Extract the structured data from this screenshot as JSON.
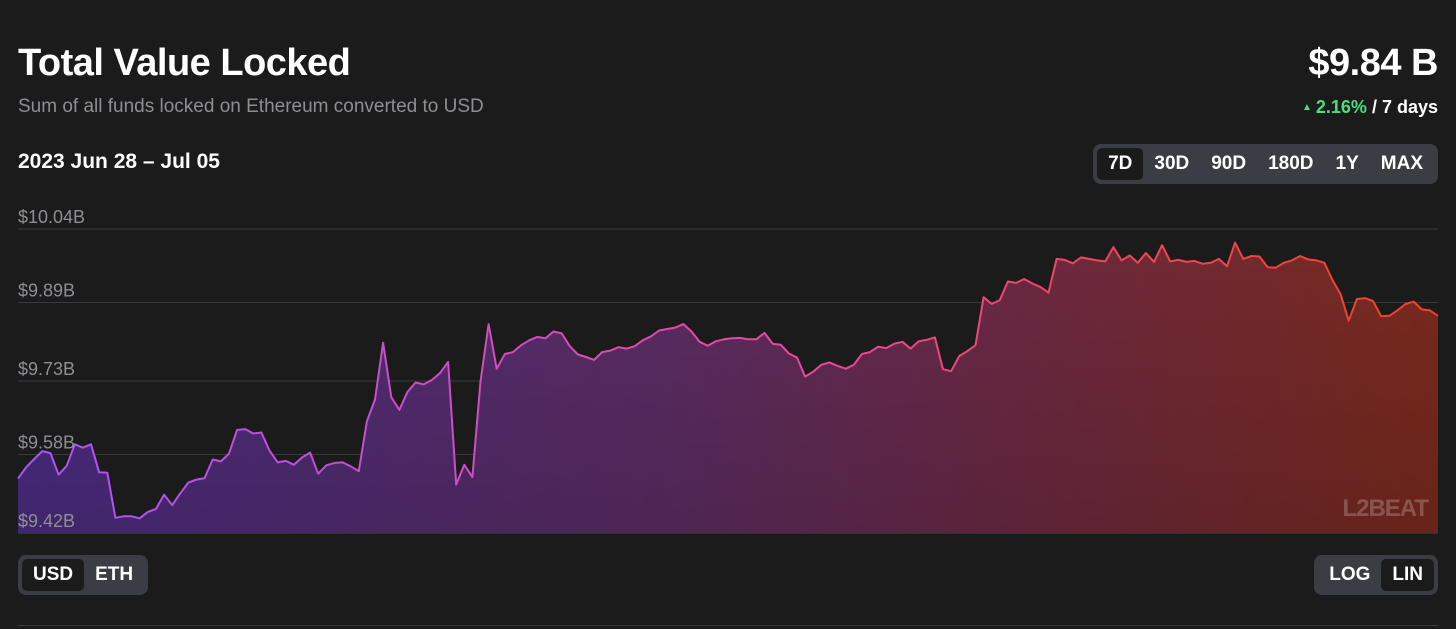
{
  "header": {
    "title": "Total Value Locked",
    "subtitle": "Sum of all funds locked on Ethereum converted to USD",
    "total_value": "$9.84 B",
    "change_arrow": "▲",
    "change_pct": "2.16%",
    "change_period": "/ 7 days"
  },
  "date_range": "2023 Jun 28 – Jul 05",
  "range_buttons": [
    "7D",
    "30D",
    "90D",
    "180D",
    "1Y",
    "MAX"
  ],
  "range_selected": "7D",
  "unit_buttons": [
    "USD",
    "ETH"
  ],
  "unit_selected": "USD",
  "scale_buttons": [
    "LOG",
    "LIN"
  ],
  "scale_selected": "LIN",
  "watermark": "L2BEAT",
  "colors": {
    "background": "#1b1b1b",
    "gradient_start": "#a855f7",
    "gradient_mid": "#ec4899",
    "gradient_end": "#ef4423",
    "positive": "#4ade80"
  },
  "chart_data": {
    "type": "area",
    "title": "Total Value Locked",
    "ylabel": "",
    "xlabel": "",
    "y_unit": "USD (billions)",
    "yticks": [
      9.42,
      9.58,
      9.73,
      9.89,
      10.04
    ],
    "ytick_labels": [
      "$9.42B",
      "$9.58B",
      "$9.73B",
      "$9.89B",
      "$10.04B"
    ],
    "ylim": [
      9.42,
      10.04
    ],
    "grid": true,
    "legend": "none",
    "x_start": "2023 Jun 28",
    "x_end": "Jul 05",
    "values": [
      9.531,
      9.554,
      9.571,
      9.587,
      9.583,
      9.539,
      9.557,
      9.601,
      9.594,
      9.601,
      9.544,
      9.543,
      9.451,
      9.454,
      9.454,
      9.45,
      9.463,
      9.469,
      9.498,
      9.477,
      9.501,
      9.523,
      9.529,
      9.532,
      9.57,
      9.566,
      9.582,
      9.63,
      9.632,
      9.623,
      9.625,
      9.588,
      9.564,
      9.567,
      9.559,
      9.574,
      9.584,
      9.541,
      9.558,
      9.563,
      9.564,
      9.556,
      9.546,
      9.648,
      9.692,
      9.808,
      9.697,
      9.671,
      9.708,
      9.727,
      9.723,
      9.732,
      9.746,
      9.769,
      9.519,
      9.559,
      9.534,
      9.729,
      9.846,
      9.755,
      9.785,
      9.789,
      9.803,
      9.813,
      9.82,
      9.817,
      9.831,
      9.827,
      9.801,
      9.784,
      9.779,
      9.773,
      9.789,
      9.792,
      9.799,
      9.796,
      9.801,
      9.813,
      9.821,
      9.833,
      9.836,
      9.839,
      9.846,
      9.831,
      9.81,
      9.802,
      9.811,
      9.815,
      9.817,
      9.818,
      9.815,
      9.815,
      9.828,
      9.806,
      9.804,
      9.786,
      9.778,
      9.739,
      9.749,
      9.763,
      9.768,
      9.761,
      9.755,
      9.763,
      9.785,
      9.789,
      9.8,
      9.797,
      9.806,
      9.81,
      9.796,
      9.811,
      9.814,
      9.819,
      9.754,
      9.75,
      9.781,
      9.791,
      9.803,
      9.901,
      9.887,
      9.895,
      9.933,
      9.93,
      9.938,
      9.929,
      9.922,
      9.91,
      9.979,
      9.977,
      9.97,
      9.982,
      9.979,
      9.976,
      9.974,
      10.003,
      9.976,
      9.986,
      9.971,
      9.991,
      9.973,
      10.007,
      9.974,
      9.977,
      9.973,
      9.975,
      9.969,
      9.971,
      9.979,
      9.964,
      10.012,
      9.979,
      9.985,
      9.984,
      9.962,
      9.961,
      9.971,
      9.976,
      9.985,
      9.978,
      9.976,
      9.971,
      9.936,
      9.907,
      9.853,
      9.897,
      9.899,
      9.893,
      9.862,
      9.863,
      9.874,
      9.887,
      9.892,
      9.876,
      9.874,
      9.863
    ]
  }
}
